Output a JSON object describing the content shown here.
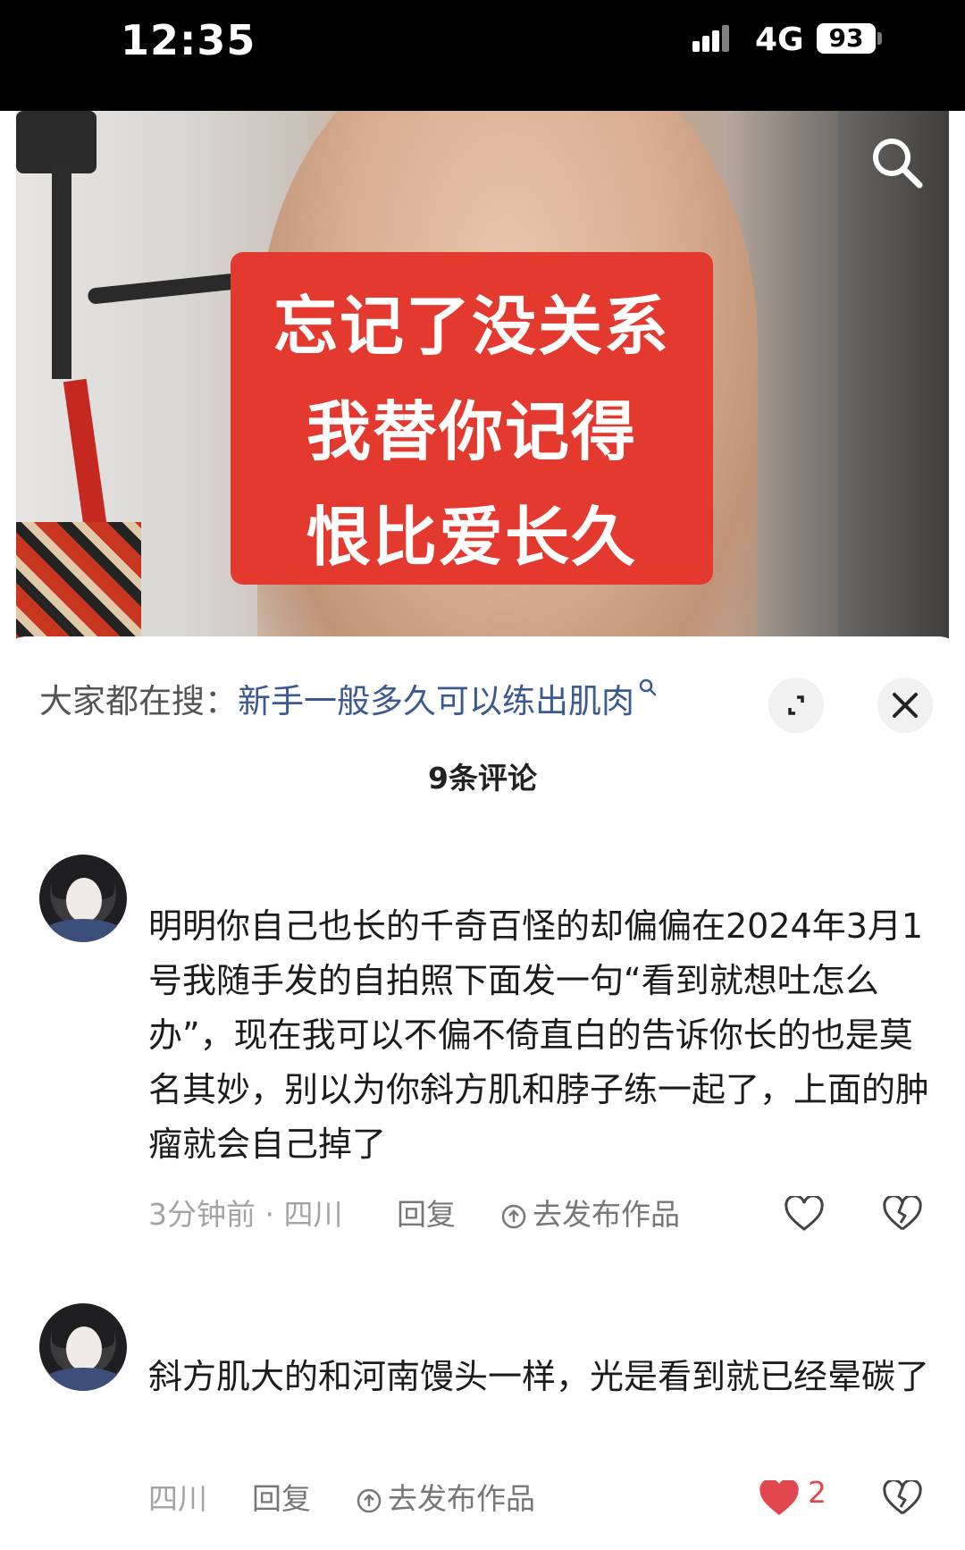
{
  "status_bar": {
    "time": "12:35",
    "network": "4G",
    "battery": "93"
  },
  "video": {
    "caption_lines": [
      "忘记了没关系",
      "我替你记得",
      "恨比爱长久"
    ],
    "caption_bg": "#e3392e"
  },
  "sheet": {
    "suggest_prefix": "大家都在搜：",
    "suggest_query": "新手一般多久可以练出肌肉",
    "comment_count": "9条评论"
  },
  "comments": [
    {
      "text": "明明你自己也长的千奇百怪的却偏偏在2024年3月1号我随手发的自拍照下面发一句“看到就想吐怎么办”，现在我可以不偏不倚直白的告诉你长的也是莫名其妙，别以为你斜方肌和脖子练一起了，上面的肿瘤就会自己掉了",
      "meta": "3分钟前 · 四川",
      "reply": "回复",
      "post": "去发布作品",
      "liked": false,
      "likes": ""
    },
    {
      "text": "斜方肌大的和河南馒头一样，光是看到就已经晕碳了",
      "meta": "四川",
      "reply": "回复",
      "post": "去发布作品",
      "liked": true,
      "likes": "2"
    }
  ],
  "colors": {
    "like_active": "#e0474f",
    "link": "#3c5a8f"
  }
}
